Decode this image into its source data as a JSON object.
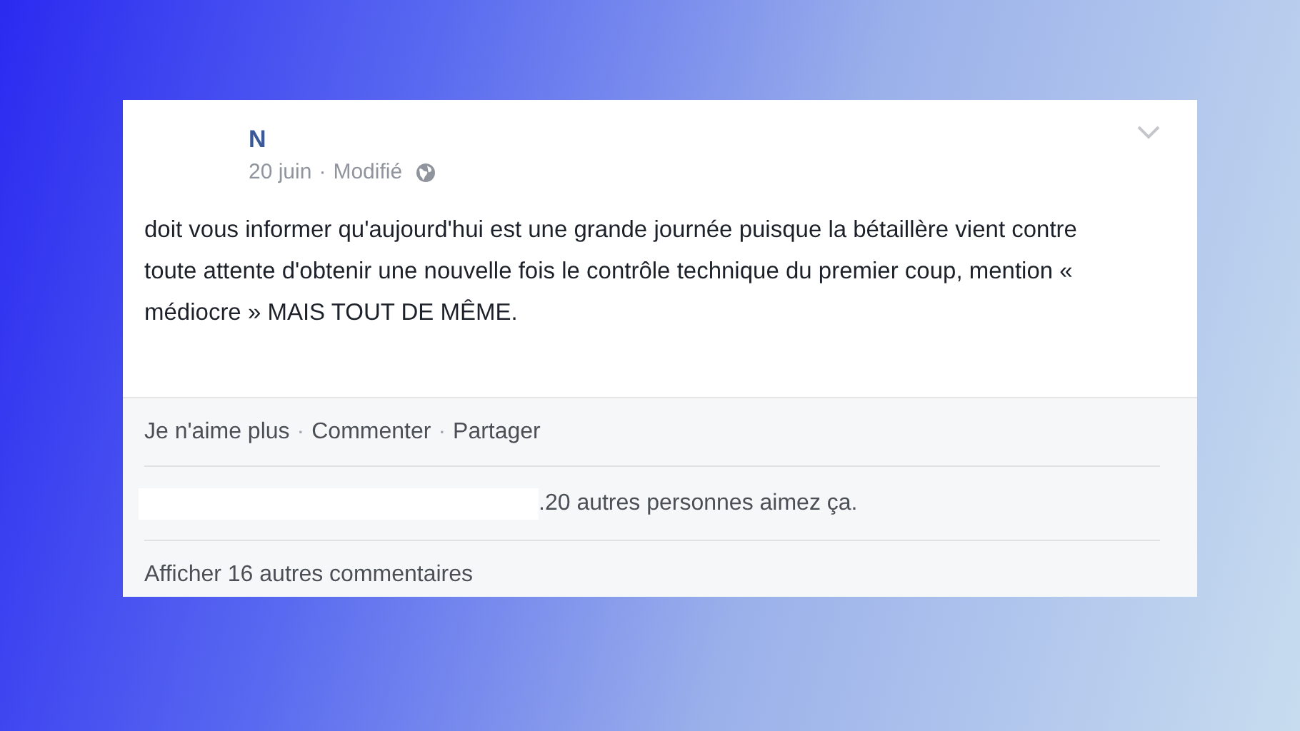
{
  "post": {
    "author": "N",
    "date": "20 juin",
    "separator": "·",
    "edited": "Modifié",
    "text": "doit vous informer qu'aujourd'hui est une grande journée puisque la bétaillère vient contre toute attente d'obtenir une nouvelle fois le contrôle technique du premier coup, mention « médiocre » MAIS TOUT DE MÊME."
  },
  "actions": [
    {
      "kind": "link",
      "text": "Je n'aime plus"
    },
    {
      "kind": "separator",
      "text": "·"
    },
    {
      "kind": "link",
      "text": "Commenter"
    },
    {
      "kind": "separator",
      "text": "·"
    },
    {
      "kind": "link",
      "text": "Partager"
    }
  ],
  "likes": ".20 autres personnes aimez ça.",
  "more_comments": "Afficher 16 autres commentaires"
}
